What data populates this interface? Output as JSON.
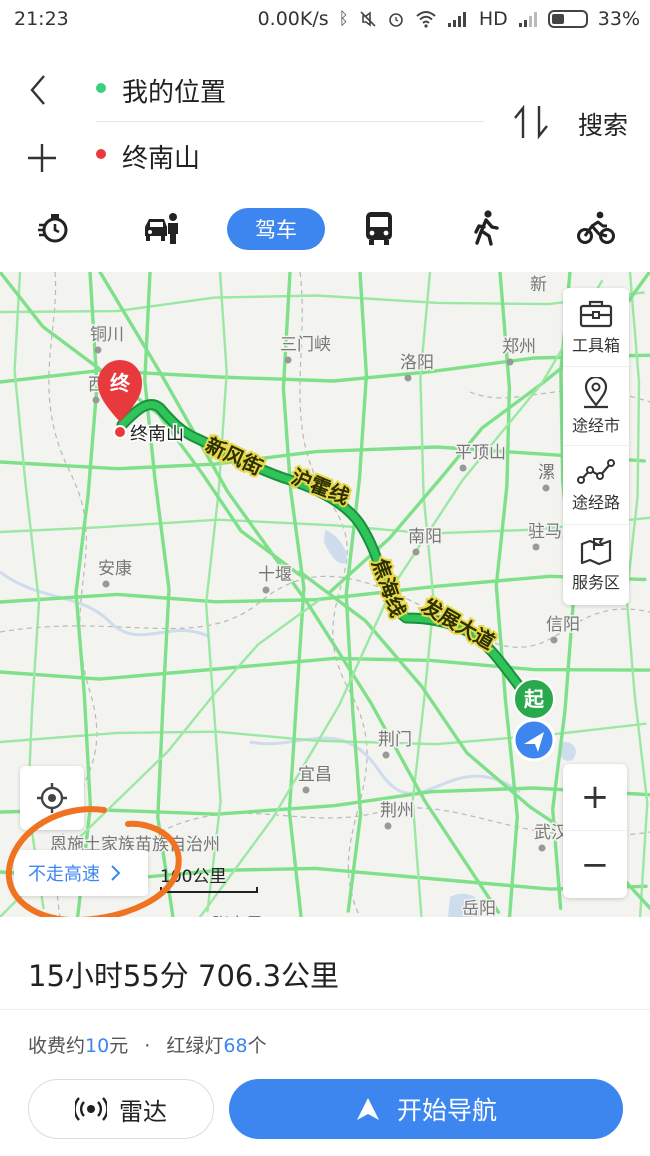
{
  "status_bar": {
    "time": "21:23",
    "net_speed": "0.00K/s",
    "signal_label": "HD",
    "battery": "33%"
  },
  "route": {
    "origin": "我的位置",
    "destination": "终南山",
    "search_label": "搜索",
    "origin_color": "#3ccf7e",
    "destination_color": "#e8393d"
  },
  "modes": {
    "active_label": "驾车",
    "items": [
      "taxi-icon",
      "carpool-icon",
      "drive",
      "bus-icon",
      "walk-icon",
      "bike-icon"
    ]
  },
  "map": {
    "tools": [
      {
        "icon": "toolbox-icon",
        "label": "工具箱"
      },
      {
        "icon": "waypoint-city-icon",
        "label": "途经市"
      },
      {
        "icon": "waypoint-road-icon",
        "label": "途经路"
      },
      {
        "icon": "service-area-icon",
        "label": "服务区"
      }
    ],
    "zoom_in": "+",
    "zoom_out": "−",
    "avoid_highway": "不走高速",
    "scale": "100公里",
    "start_marker": "起",
    "end_marker": "终",
    "end_label": "终南山",
    "cities": [
      {
        "name": "铜川"
      },
      {
        "name": "西安"
      },
      {
        "name": "三门峡"
      },
      {
        "name": "洛阳"
      },
      {
        "name": "郑州"
      },
      {
        "name": "平顶山"
      },
      {
        "name": "漯"
      },
      {
        "name": "驻马店"
      },
      {
        "name": "南阳"
      },
      {
        "name": "安康"
      },
      {
        "name": "十堰"
      },
      {
        "name": "信阳"
      },
      {
        "name": "荆门"
      },
      {
        "name": "宜昌"
      },
      {
        "name": "荆州"
      },
      {
        "name": "武汉"
      },
      {
        "name": "岳阳"
      },
      {
        "name": "张家界"
      },
      {
        "name": "恩施土家族苗族自治州"
      },
      {
        "name": "新"
      }
    ],
    "road_labels": [
      {
        "name": "新风街"
      },
      {
        "name": "沪霍线"
      },
      {
        "name": "焦海线"
      },
      {
        "name": "发展大道"
      }
    ],
    "route_color": "#1fb24a",
    "road_color": "#7fe08a"
  },
  "summary": {
    "duration_distance": "15小时55分  706.3公里",
    "toll_prefix": "收费约",
    "toll_value": "10",
    "toll_suffix": "元",
    "separator": "·",
    "lights_prefix": "红绿灯",
    "lights_value": "68",
    "lights_suffix": "个",
    "radar_label": "雷达",
    "navigate_label": "开始导航",
    "accent": "#3d86f0"
  }
}
